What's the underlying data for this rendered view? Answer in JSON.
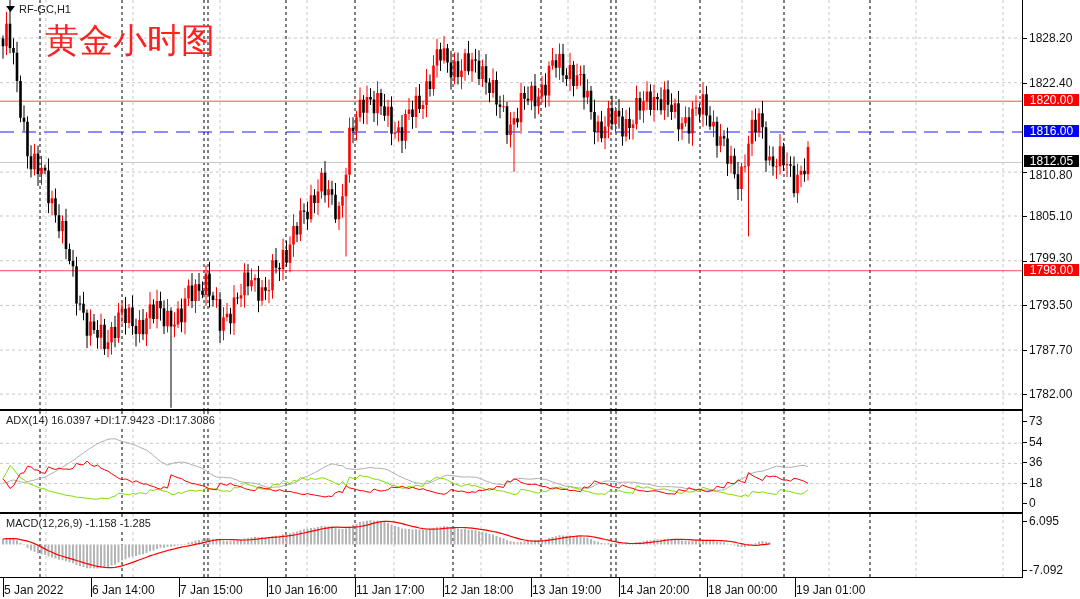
{
  "symbol": "RF-GC,H1",
  "title": "黄金小时图",
  "price_axis": {
    "ticks": [
      "1828.20",
      "1822.40",
      "1810.80",
      "1805.10",
      "1799.30",
      "1793.50",
      "1787.70",
      "1782.00"
    ]
  },
  "price_levels": [
    {
      "label": "1820.00",
      "kind": "line",
      "color": "#ff0000"
    },
    {
      "label": "1816.00",
      "kind": "dashed",
      "color": "#0000ff"
    },
    {
      "label": "1812.05",
      "kind": "current",
      "color": "#000000"
    },
    {
      "label": "1798.00",
      "kind": "line",
      "color": "#ff0000"
    }
  ],
  "adx": {
    "label": "ADX(14) 16.0397 +DI:17.9423 -DI:17.3086",
    "ticks": [
      "73",
      "54",
      "36",
      "18",
      "0"
    ]
  },
  "macd": {
    "label": "MACD(12,26,9) -1.158 -1.285",
    "ticks": [
      "6.095",
      "-7.092"
    ]
  },
  "time_axis": [
    "5 Jan 2022",
    "6 Jan 14:00",
    "7 Jan 15:00",
    "10 Jan 16:00",
    "11 Jan 17:00",
    "12 Jan 18:00",
    "13 Jan 19:00",
    "14 Jan 20:00",
    "18 Jan 00:00",
    "19 Jan 01:00"
  ]
}
